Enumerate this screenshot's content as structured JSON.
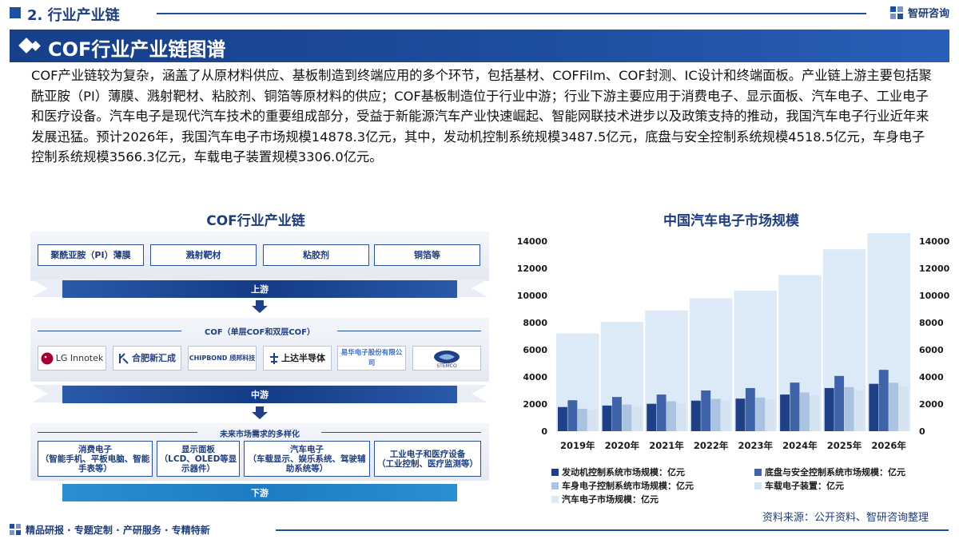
{
  "header": {
    "section_title": "2. 行业产业链",
    "brand_name": "智研咨询"
  },
  "banner": {
    "title": "COF行业产业链图谱"
  },
  "paragraph": "COF产业链较为复杂，涵盖了从原材料供应、基板制造到终端应用的多个环节，包括基材、COFFilm、COF封测、IC设计和终端面板。产业链上游主要包括聚酰亚胺（PI）薄膜、溅射靶材、粘胶剂、铜箔等原材料的供应；COF基板制造位于行业中游；行业下游主要应用于消费电子、显示面板、汽车电子、工业电子和医疗设备。汽车电子是现代汽车技术的重要组成部分，受益于新能源汽车产业快速崛起、智能网联技术进步以及政策支持的推动，我国汽车电子行业近年来发展迅猛。预计2026年，我国汽车电子市场规模14878.3亿元，其中，发动机控制系统规模3487.5亿元，底盘与安全控制系统规模4518.5亿元，车身电子控制系统规模3566.3亿元，车载电子装置规模3306.0亿元。",
  "chain": {
    "title": "COF行业产业链",
    "upstream_items": [
      "聚酰亚胺（PI）薄膜",
      "溅射靶材",
      "粘胶剂",
      "铜箔等"
    ],
    "upstream_label": "上游",
    "midstream_sublabel": "COF（单层COF和双层COF）",
    "midstream_companies": [
      "LG Innotek",
      "合肥新汇成",
      "CHIPBOND 颀邦科技",
      "上达半导体",
      "易华电子股份有限公司",
      "STEMCO"
    ],
    "midstream_label": "中游",
    "downstream_sublabel": "未来市场需求的多样化",
    "downstream_items": [
      {
        "name": "消费电子",
        "detail": "（智能手机、平板电脑、智能手表等）"
      },
      {
        "name": "显示面板",
        "detail": "（LCD、OLED等显示器件）"
      },
      {
        "name": "汽车电子",
        "detail": "（车载显示、娱乐系统、驾驶辅助系统等）"
      },
      {
        "name": "工业电子和医疗设备",
        "detail": "（工业控制、医疗监测等）"
      }
    ],
    "downstream_label": "下游"
  },
  "chart_data": {
    "type": "bar",
    "title": "中国汽车电子市场规模",
    "categories": [
      "2019年",
      "2020年",
      "2021年",
      "2022年",
      "2023年",
      "2024年",
      "2025年",
      "2026年"
    ],
    "ylim": [
      0,
      14000
    ],
    "yticks": [
      0,
      2000,
      4000,
      6000,
      8000,
      10000,
      12000,
      14000
    ],
    "series": [
      {
        "name": "发动机控制系统市场规模：亿元",
        "color": "#1f3f86",
        "values": [
          1780,
          1890,
          2020,
          2250,
          2400,
          2700,
          3180,
          3490
        ]
      },
      {
        "name": "底盘与安全控制系统市场规模：亿元",
        "color": "#3f63a8",
        "values": [
          2280,
          2520,
          2700,
          3000,
          3180,
          3580,
          4070,
          4520
        ]
      },
      {
        "name": "车身电子控制系统市场规模：亿元",
        "color": "#a9c3e0",
        "values": [
          1650,
          1960,
          2200,
          2380,
          2480,
          2850,
          3250,
          3570
        ]
      },
      {
        "name": "车载电子装置：亿元",
        "color": "#d5e2ef",
        "values": [
          1580,
          1790,
          2050,
          2240,
          2370,
          2650,
          3000,
          3310
        ]
      },
      {
        "name": "汽车电子市场规模：亿元",
        "color": "#dbeaf6",
        "values": [
          7200,
          8050,
          8900,
          9800,
          10350,
          11500,
          13400,
          14880
        ]
      }
    ]
  },
  "source": "资料来源：公开资料、智研咨询整理",
  "footer": {
    "text": "精品研报 · 专题定制 · 产研服务 · 专精特新"
  }
}
